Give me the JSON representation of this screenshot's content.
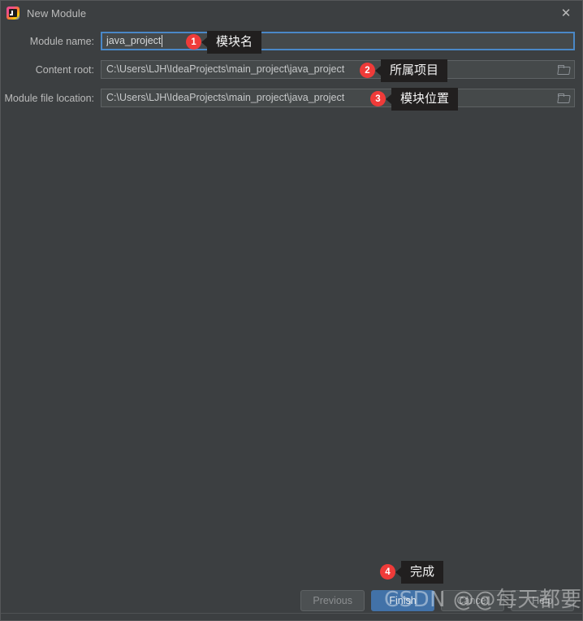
{
  "window": {
    "title": "New Module",
    "app_icon": "intellij-idea-icon",
    "close_icon": "close-icon",
    "background_color": "#3c3f41",
    "accent_color": "#4272a8",
    "annotation_color": "#ef3b39"
  },
  "form": {
    "rows": [
      {
        "label": "Module name:",
        "value": "java_project",
        "placeholder": "",
        "focused": true,
        "has_browse": false,
        "browse_icon": "folder-icon"
      },
      {
        "label": "Content root:",
        "value": "C:\\Users\\LJH\\IdeaProjects\\main_project\\java_project",
        "placeholder": "",
        "focused": false,
        "has_browse": true,
        "browse_icon": "folder-icon"
      },
      {
        "label": "Module file location:",
        "value": "C:\\Users\\LJH\\IdeaProjects\\main_project\\java_project",
        "placeholder": "",
        "focused": false,
        "has_browse": true,
        "browse_icon": "folder-icon"
      }
    ]
  },
  "annotations": [
    {
      "number": "1",
      "text": "模块名"
    },
    {
      "number": "2",
      "text": "所属项目"
    },
    {
      "number": "3",
      "text": "模块位置"
    },
    {
      "number": "4",
      "text": "完成"
    }
  ],
  "footer": {
    "buttons": [
      {
        "label": "Previous",
        "style": "disabled"
      },
      {
        "label": "Finish",
        "style": "primary"
      },
      {
        "label": "Cancel",
        "style": "normal"
      },
      {
        "label": "Help",
        "style": "normal"
      }
    ]
  },
  "watermark": {
    "text": "CSDN @@每天都要敲代码"
  }
}
